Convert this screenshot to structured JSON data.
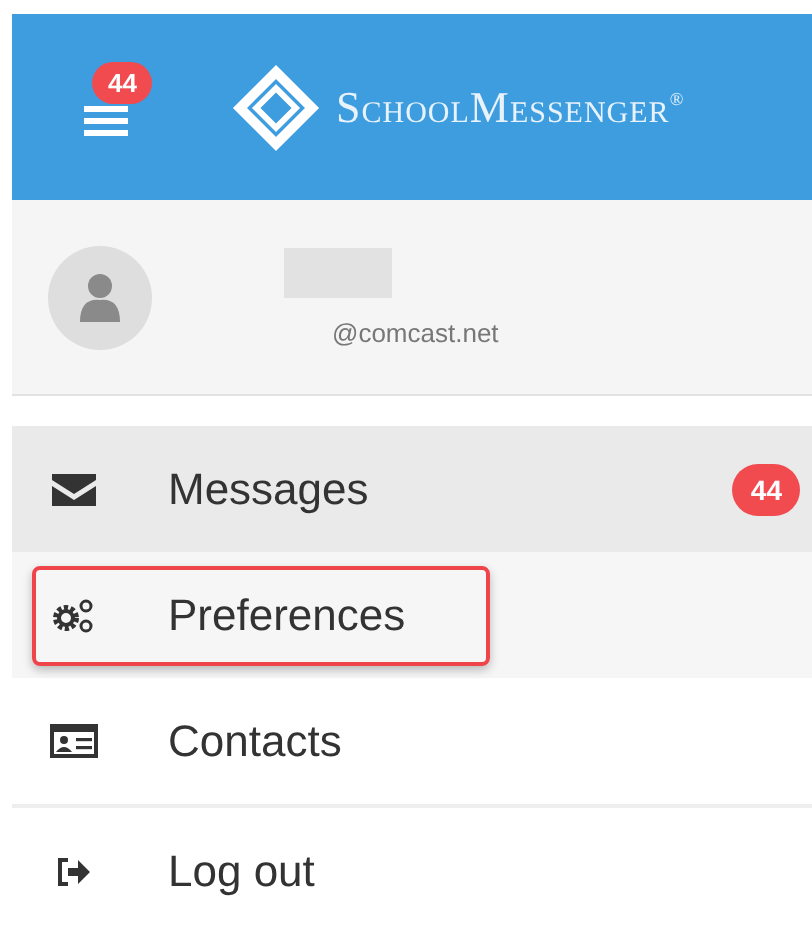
{
  "header": {
    "menu_badge": "44",
    "logo_text": "SchoolMessenger$^{®}$"
  },
  "profile": {
    "email": "@comcast.net"
  },
  "menu_sections": [
    [
      {
        "label": "Messages",
        "kind": "envelope",
        "badge": "44",
        "selected": true,
        "highlighted": false
      },
      {
        "label": "Preferences",
        "kind": "gears",
        "selected": false,
        "highlighted": true
      },
      {
        "label": "Contacts",
        "kind": "card",
        "selected": false,
        "highlighted": false
      }
    ],
    [
      {
        "label": "Log out",
        "kind": "logout",
        "selected": false,
        "highlighted": false
      }
    ]
  ]
}
